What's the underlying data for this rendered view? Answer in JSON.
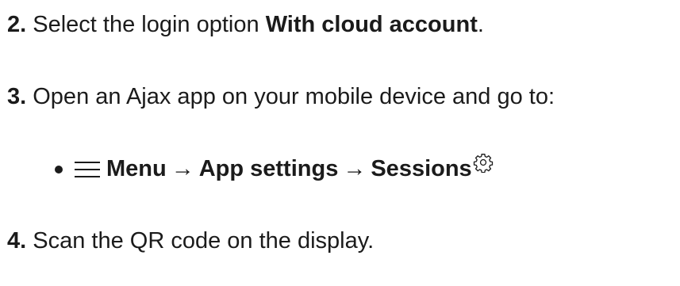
{
  "steps": [
    {
      "number": "2.",
      "text_before": "Select the login option ",
      "bold": "With cloud account",
      "text_after": "."
    },
    {
      "number": "3.",
      "text": "Open an Ajax app on your mobile device and go to:"
    },
    {
      "number": "4.",
      "text": "Scan the QR code on the display."
    }
  ],
  "path": {
    "menu": "Menu",
    "arrow": "→",
    "app_settings": "App settings",
    "sessions": "Sessions",
    "icons": [
      "menu-icon",
      "gear-icon"
    ]
  },
  "colors": {
    "text": "#1b1b1b",
    "background": "#ffffff"
  }
}
